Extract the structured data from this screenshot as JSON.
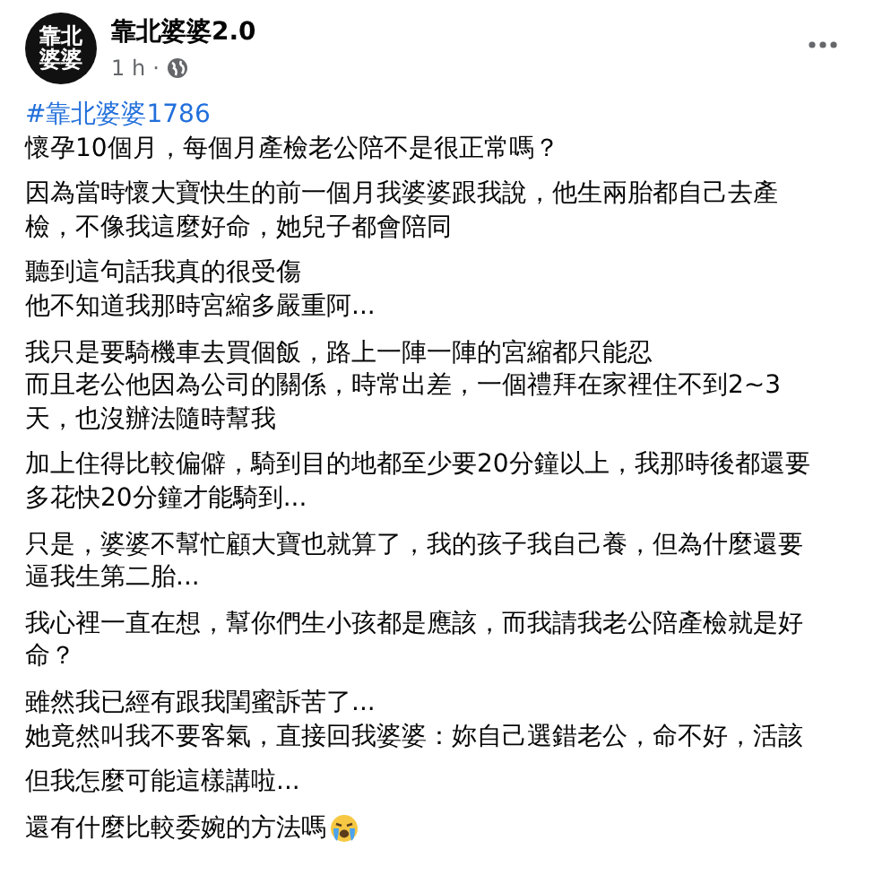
{
  "post": {
    "avatar_text": [
      "靠北",
      "婆婆"
    ],
    "author": "靠北婆婆2.0",
    "time": "1 h",
    "separator": "·",
    "hashtag": "#靠北婆婆1786",
    "paragraphs": [
      {
        "lines": [
          "懷孕10個月，每個月產檢老公陪不是很正常嗎？"
        ]
      },
      {
        "lines": [
          "因為當時懷大寶快生的前一個月我婆婆跟我說，他生兩胎都自己去產",
          "檢，不像我這麼好命，她兒子都會陪同"
        ]
      },
      {
        "lines": [
          "聽到這句話我真的很受傷",
          "他不知道我那時宮縮多嚴重阿..."
        ]
      },
      {
        "lines": [
          "我只是要騎機車去買個飯，路上一陣一陣的宮縮都只能忍",
          "而且老公他因為公司的關係，時常出差，一個禮拜在家裡住不到2~3",
          "天，也沒辦法隨時幫我"
        ]
      },
      {
        "lines": [
          "加上住得比較偏僻，騎到目的地都至少要20分鐘以上，我那時後都還要",
          "多花快20分鐘才能騎到..."
        ]
      },
      {
        "lines": [
          "只是，婆婆不幫忙顧大寶也就算了，我的孩子我自己養，但為什麼還要",
          "逼我生第二胎..."
        ]
      },
      {
        "lines": [
          "我心裡一直在想，幫你們生小孩都是應該，而我請我老公陪產檢就是好",
          "命？"
        ]
      },
      {
        "lines": [
          "雖然我已經有跟我閨蜜訴苦了...",
          "她竟然叫我不要客氣，直接回我婆婆：妳自己選錯老公，命不好，活該"
        ]
      },
      {
        "lines": [
          "但我怎麼可能這樣講啦..."
        ]
      },
      {
        "lines": [
          "還有什麼比較委婉的方法嗎"
        ],
        "crying_emoji": true
      }
    ]
  }
}
